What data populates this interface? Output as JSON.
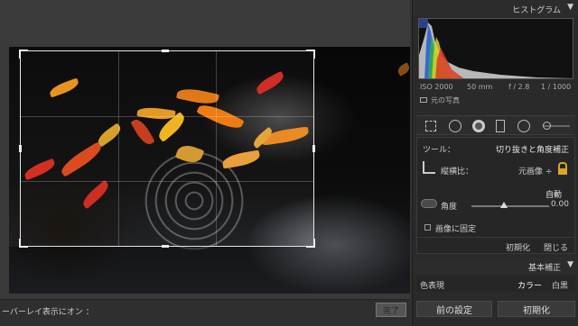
{
  "canvas": {
    "bottom_left_text": "ーバーレイ表示にオン ：",
    "done_label": "完了"
  },
  "panel": {
    "histogram_title": "ヒストグラム",
    "histogram_meta": {
      "iso": "ISO 2000",
      "focal": "50 mm",
      "aperture": "f / 2.8",
      "shutter": "1 / 1000"
    },
    "original_photo_label": "元の写真",
    "tool_label": "ツール：",
    "tool_name": "切り抜きと角度補正",
    "aspect_label": "縦横比：",
    "aspect_value": "元画像 ÷",
    "auto_label": "自動",
    "angle_label": "角度",
    "angle_value": "0.00",
    "constrain_label": "画像に固定",
    "reset_label": "初期化",
    "close_label": "閉じる",
    "basic_title": "基本補正",
    "treatment_label": "色表現",
    "color_label": "カラー",
    "bw_label": "白黒",
    "previous_button": "前の設定",
    "reset_button": "初期化"
  },
  "colors": {
    "panel_bg": "#2a2a2a",
    "canvas_bg": "#3a3a3a",
    "leaf_orange": "#e07a1a",
    "leaf_red": "#c8321e"
  }
}
